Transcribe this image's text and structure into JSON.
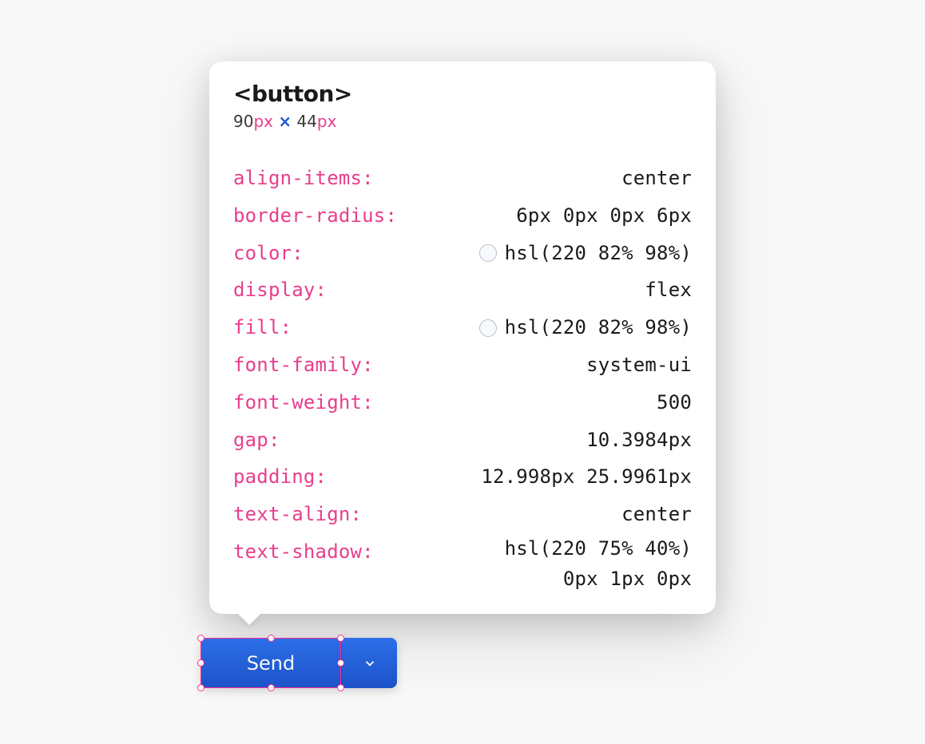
{
  "inspector": {
    "element_tag": "<button>",
    "dimensions": {
      "width_value": "90",
      "width_unit": "px",
      "separator": "×",
      "height_value": "44",
      "height_unit": "px"
    },
    "properties": [
      {
        "name": "align-items:",
        "value": "center",
        "has_swatch": false
      },
      {
        "name": "border-radius:",
        "value": "6px 0px 0px 6px",
        "has_swatch": false
      },
      {
        "name": "color:",
        "value": "hsl(220 82% 98%)",
        "has_swatch": true
      },
      {
        "name": "display:",
        "value": "flex",
        "has_swatch": false
      },
      {
        "name": "fill:",
        "value": "hsl(220 82% 98%)",
        "has_swatch": true
      },
      {
        "name": "font-family:",
        "value": "system-ui",
        "has_swatch": false
      },
      {
        "name": "font-weight:",
        "value": "500",
        "has_swatch": false
      },
      {
        "name": "gap:",
        "value": "10.3984px",
        "has_swatch": false
      },
      {
        "name": "padding:",
        "value": "12.998px 25.9961px",
        "has_swatch": false
      },
      {
        "name": "text-align:",
        "value": "center",
        "has_swatch": false
      },
      {
        "name": "text-shadow:",
        "value": "hsl(220 75% 40%)\n0px 1px 0px",
        "has_swatch": false
      }
    ]
  },
  "buttons": {
    "send_label": "Send"
  }
}
